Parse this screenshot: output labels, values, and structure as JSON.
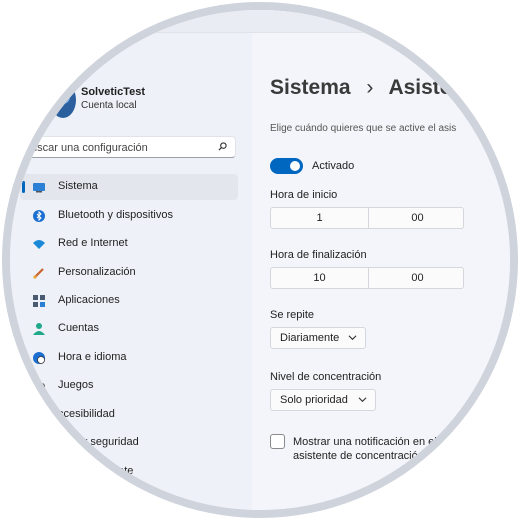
{
  "user": {
    "name": "SolveticTest",
    "account_type": "Cuenta local"
  },
  "search": {
    "placeholder": "uscar una configuración"
  },
  "sidebar": {
    "items": [
      {
        "label": "Sistema",
        "icon": "monitor-icon",
        "active": true
      },
      {
        "label": "Bluetooth y dispositivos",
        "icon": "bluetooth-icon"
      },
      {
        "label": "Red e Internet",
        "icon": "wifi-icon"
      },
      {
        "label": "Personalización",
        "icon": "brush-icon"
      },
      {
        "label": "Aplicaciones",
        "icon": "apps-icon"
      },
      {
        "label": "Cuentas",
        "icon": "person-icon"
      },
      {
        "label": "Hora e idioma",
        "icon": "clock-globe-icon"
      },
      {
        "label": "Juegos",
        "icon": "gamepad-icon"
      },
      {
        "label": "ccesibilidad",
        "icon": "accessibility-icon"
      },
      {
        "label": "idad y seguridad",
        "icon": "shield-icon"
      },
      {
        "label": "date",
        "icon": "update-icon"
      }
    ]
  },
  "main": {
    "breadcrumb_parent": "Sistema",
    "breadcrumb_separator": "›",
    "breadcrumb_current": "Asister",
    "description": "Elige cuándo quieres que se active el asis",
    "toggle": {
      "label": "Activado",
      "on": true
    },
    "start_time": {
      "label": "Hora de inicio",
      "hour": "1",
      "minute": "00"
    },
    "end_time": {
      "label": "Hora de finalización",
      "hour": "10",
      "minute": "00"
    },
    "repeat": {
      "label": "Se repite",
      "value": "Diariamente"
    },
    "focus_level": {
      "label": "Nivel de concentración",
      "value": "Solo prioridad"
    },
    "notification": {
      "line1": "Mostrar una notificación en el",
      "line2": "asistente de concentración"
    }
  },
  "colors": {
    "accent": "#0067c0",
    "sidebar_bg": "#eef1f7",
    "content_bg": "#f3f5fa",
    "border": "#cfd3dc"
  }
}
